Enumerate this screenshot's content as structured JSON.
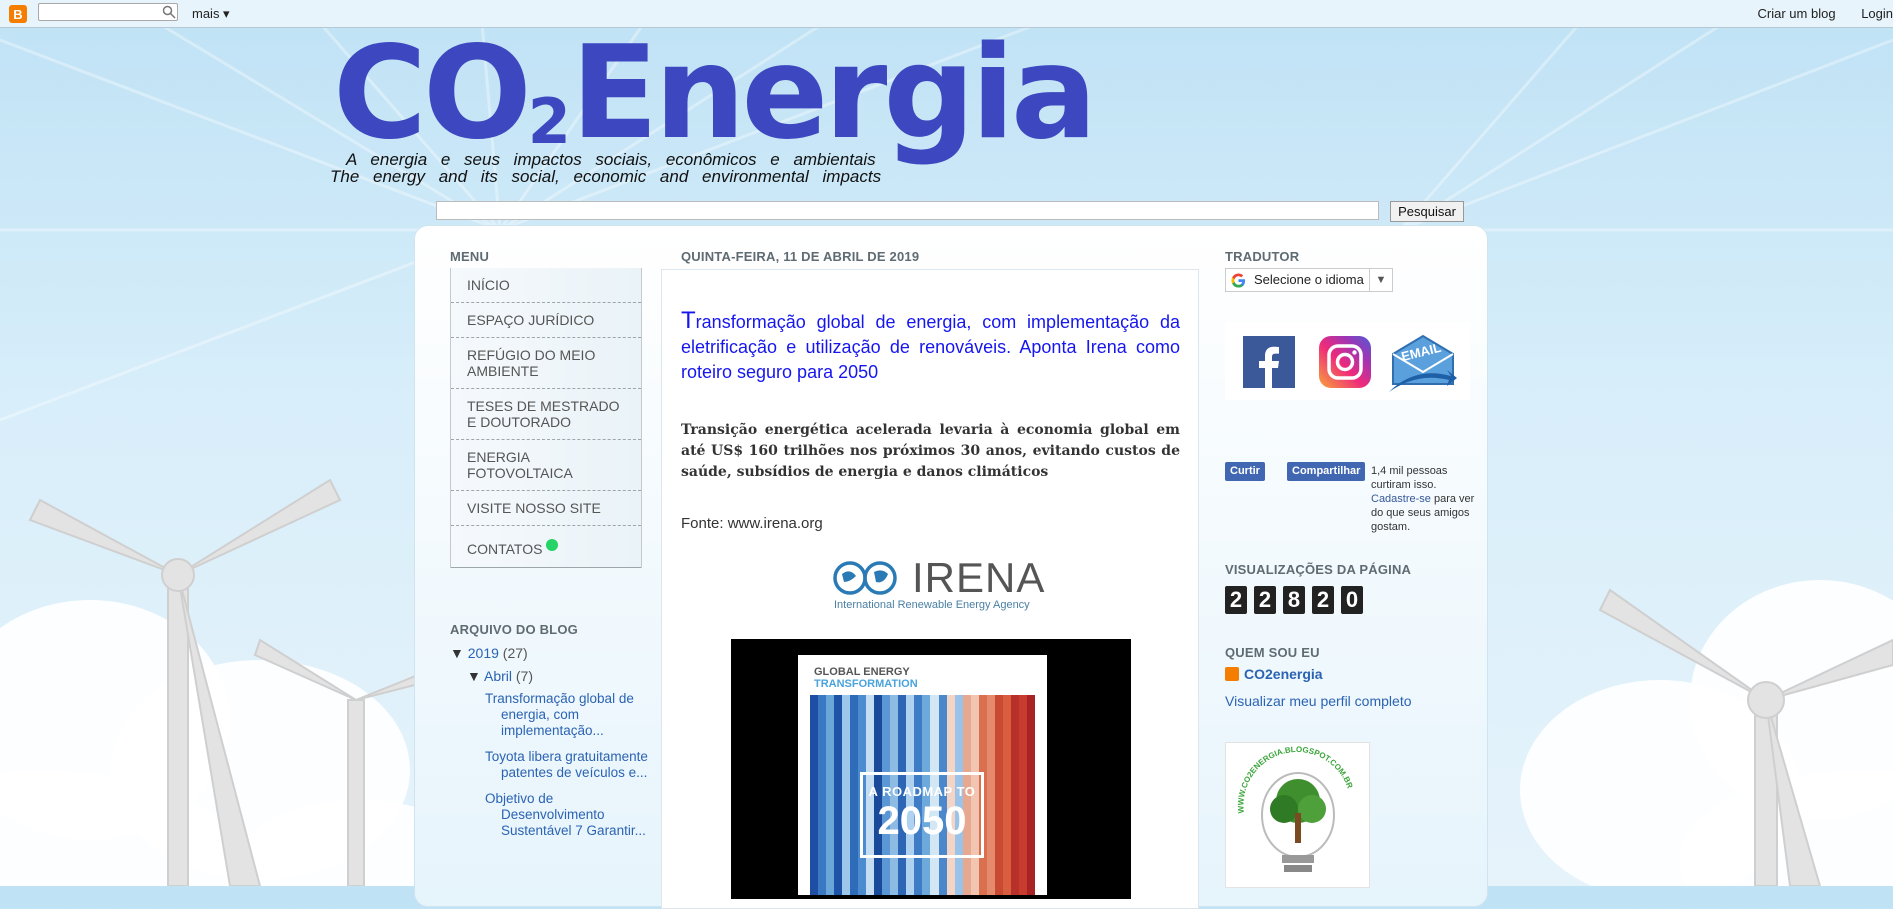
{
  "navbar": {
    "more_label": "mais ▾",
    "create_blog": "Criar um blog",
    "login": "Login"
  },
  "header": {
    "title_part1": "CO",
    "title_sub": "2",
    "title_part2": "Energia",
    "tagline_pt": "A energia e seus impactos sociais, econômicos e ambientais",
    "tagline_en": "The energy and its social, economic and environmental impacts"
  },
  "search": {
    "button_label": "Pesquisar"
  },
  "menu": {
    "title": "MENU",
    "items": [
      {
        "label": "INÍCIO"
      },
      {
        "label": "ESPAÇO JURÍDICO"
      },
      {
        "label": "REFÚGIO DO MEIO AMBIENTE"
      },
      {
        "label": "TESES DE MESTRADO E DOUTORADO"
      },
      {
        "label": "ENERGIA FOTOVOLTAICA"
      },
      {
        "label": "VISITE NOSSO SITE"
      },
      {
        "label": "CONTATOS"
      }
    ]
  },
  "archive": {
    "title": "ARQUIVO DO BLOG",
    "year": "2019",
    "year_count": "(27)",
    "month": "Abril",
    "month_count": "(7)",
    "posts": [
      "Transformação global de energia, com implementação...",
      "Toyota libera gratuitamente patentes de veículos e...",
      "Objetivo de Desenvolvimento Sustentável 7 Garantir..."
    ]
  },
  "post": {
    "date": "QUINTA-FEIRA, 11 DE ABRIL DE 2019",
    "title_first_letter": "T",
    "title_rest": "ransformação global de energia, com implementação da eletrificação e utilização de renováveis. Aponta Irena como roteiro seguro para 2050",
    "subtitle": "Transição energética acelerada levaria à economia global em até US$ 160 trilhões nos próximos 30 anos, evitando custos de saúde, subsídios de energia e danos climáticos",
    "source": "Fonte: www.irena.org",
    "irena_logo": "IRENA",
    "irena_sub": "International Renewable Energy Agency",
    "book_line1": "GLOBAL ENERGY",
    "book_line2": "TRANSFORMATION",
    "book_roadmap": "A ROADMAP TO",
    "book_year": "2050"
  },
  "sidebar": {
    "translator_title": "TRADUTOR",
    "translator_select": "Selecione o idioma",
    "email_label": "EMAIL",
    "fb_like": "Curtir",
    "fb_share": "Compartilhar",
    "like_count": "1,4 mil pessoas curtiram isso.",
    "like_signup": "Cadastre-se",
    "like_rest": " para ver do que seus amigos gostam.",
    "views_title": "VISUALIZAÇÕES DA PÁGINA",
    "views_digits": [
      "2",
      "2",
      "8",
      "2",
      "0"
    ],
    "who_title": "QUEM SOU EU",
    "who_name": "CO2energia",
    "who_link": "Visualizar meu perfil completo",
    "bulb_text": "WWW.CO2ENERGIA.BLOGSPOT.COM.BR"
  },
  "colors": {
    "title_blue": "#3c47c0",
    "post_title_blue": "#1616ee",
    "link_blue": "#2b63b3",
    "blogger_orange": "#f57d00"
  }
}
